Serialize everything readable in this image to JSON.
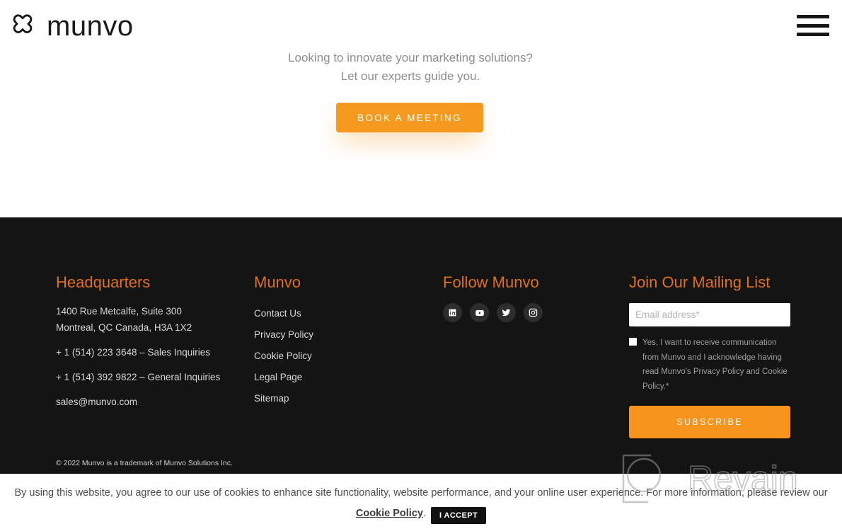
{
  "header": {
    "logo_mark": "munvo-clover-mark",
    "logo_text": "munvo",
    "menu_icon": "hamburger-menu-icon"
  },
  "hero": {
    "line1": "Looking to innovate your marketing solutions?",
    "line2": "Let our experts guide you.",
    "cta_label": "BOOK A MEETING",
    "cta_color": "#F59A1E"
  },
  "footer": {
    "background": "#141414",
    "heading_color": "#DD711E",
    "headquarters": {
      "title": "Headquarters",
      "address_line1": "1400 Rue Metcalfe, Suite 300",
      "address_line2": "Montreal, QC Canada, H3A 1X2",
      "phone_sales": "+ 1 (514) 223 3648 – Sales Inquiries",
      "phone_general": "+ 1 (514) 392 9822 – General Inquiries",
      "email": "sales@munvo.com"
    },
    "munvo": {
      "title": "Munvo",
      "links": [
        {
          "label": "Contact Us"
        },
        {
          "label": "Privacy Policy"
        },
        {
          "label": "Cookie Policy"
        },
        {
          "label": "Legal Page"
        },
        {
          "label": "Sitemap"
        }
      ]
    },
    "follow": {
      "title": "Follow Munvo",
      "socials": [
        {
          "name": "linkedin-icon"
        },
        {
          "name": "youtube-icon"
        },
        {
          "name": "twitter-icon"
        },
        {
          "name": "instagram-icon"
        }
      ]
    },
    "mailing": {
      "title": "Join Our Mailing List",
      "email_placeholder": "Email address*",
      "email_value": "",
      "consent_text": "Yes, I want to receive communication from Munvo and I acknowledge having read Munvo's Privacy Policy and Cookie Policy.*",
      "consent_checked": false,
      "subscribe_label": "SUBSCRIBE",
      "subscribe_color": "#F7941D"
    },
    "copyright": "© 2022 Munvo is a trademark of Munvo Solutions Inc."
  },
  "cookie_banner": {
    "text_before": "By using this website, you agree to our use of cookies to enhance site functionality, website performance, and your online user experience. For more information, please review our ",
    "link_label": "Cookie Policy",
    "text_after": ".",
    "accept_label": "I ACCEPT"
  },
  "watermark": {
    "text": "Revain"
  }
}
